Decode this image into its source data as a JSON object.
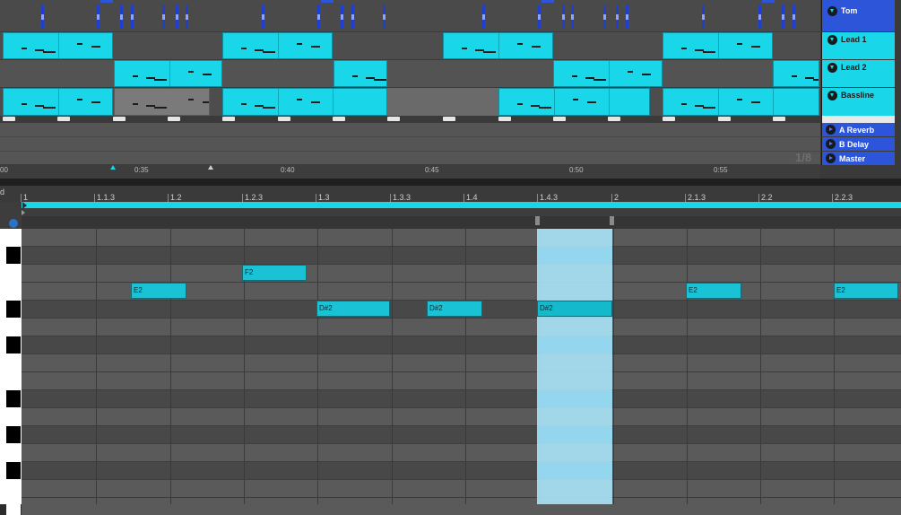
{
  "arrangement": {
    "tracks": [
      {
        "name": "Tom",
        "icon": "fold-triangle-icon",
        "color": "#2c55d9"
      },
      {
        "name": "Lead 1",
        "icon": "fold-triangle-icon",
        "color": "#19d6e8"
      },
      {
        "name": "Lead 2",
        "icon": "fold-triangle-icon",
        "color": "#19d6e8"
      },
      {
        "name": "Bassline",
        "icon": "fold-triangle-icon",
        "color": "#19d6e8"
      }
    ],
    "returns": [
      {
        "name": "A Reverb",
        "icon": "play-triangle-icon"
      },
      {
        "name": "B Delay",
        "icon": "play-triangle-icon"
      },
      {
        "name": "Master",
        "icon": "play-triangle-icon"
      }
    ],
    "time_labels": [
      "0:35",
      "0:40",
      "0:45",
      "0:50",
      "0:55"
    ],
    "partial_time_label": "00",
    "grid_fraction": "1/8"
  },
  "editor": {
    "partial_label": "d",
    "beat_labels": [
      "1",
      "1.1.3",
      "1.2",
      "1.2.3",
      "1.3",
      "1.3.3",
      "1.4",
      "1.4.3",
      "2",
      "2.1.3",
      "2.2",
      "2.2.3"
    ],
    "notes": [
      {
        "pitch": "E2"
      },
      {
        "pitch": "F2"
      },
      {
        "pitch": "D#2"
      },
      {
        "pitch": "D#2"
      },
      {
        "pitch": "D#2"
      },
      {
        "pitch": "E2"
      },
      {
        "pitch": "E2"
      }
    ],
    "colors": {
      "note": "#19c2d4",
      "selection": "#a8e4f8",
      "loop_bar": "#19d6e8"
    }
  }
}
